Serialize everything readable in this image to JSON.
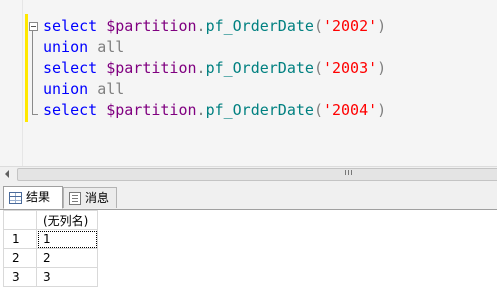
{
  "editor": {
    "lines": [
      {
        "kw": "select",
        "var": "$partition",
        "fn": "pf_OrderDate",
        "str": "'2002'"
      },
      {
        "kw": "union",
        "op": "all"
      },
      {
        "kw": "select",
        "var": "$partition",
        "fn": "pf_OrderDate",
        "str": "'2003'"
      },
      {
        "kw": "union",
        "op": "all"
      },
      {
        "kw": "select",
        "var": "$partition",
        "fn": "pf_OrderDate",
        "str": "'2004'"
      }
    ]
  },
  "tabs": {
    "results_label": "结果",
    "results_icon": "grid-icon",
    "messages_label": "消息",
    "messages_icon": "message-icon"
  },
  "grid": {
    "column_header": "(无列名)",
    "rows": [
      {
        "num": "1",
        "value": "1"
      },
      {
        "num": "2",
        "value": "2"
      },
      {
        "num": "3",
        "value": "3"
      }
    ]
  }
}
